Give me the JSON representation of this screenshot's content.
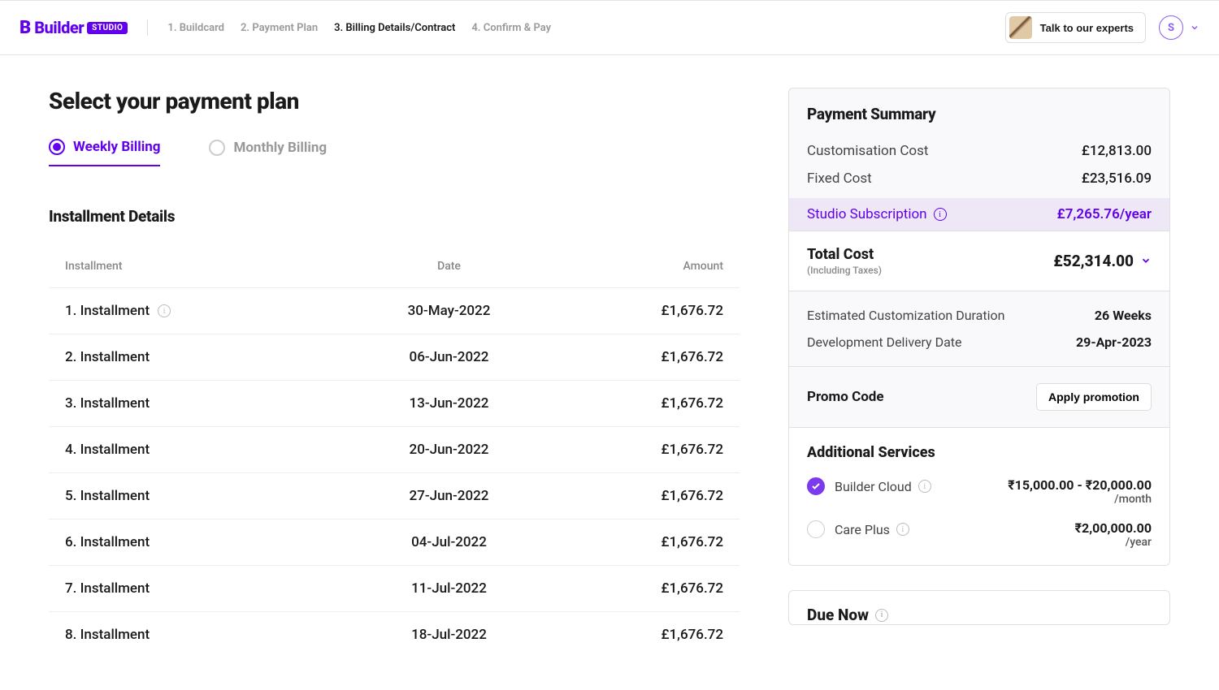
{
  "logo": {
    "brand": "Builder",
    "badge": "STUDIO"
  },
  "breadcrumbs": [
    {
      "label": "1. Buildcard",
      "active": false
    },
    {
      "label": "2. Payment Plan",
      "active": false
    },
    {
      "label": "3. Billing Details/Contract",
      "active": true
    },
    {
      "label": "4. Confirm & Pay",
      "active": false
    }
  ],
  "header": {
    "expert_label": "Talk to our experts",
    "user_initial": "S"
  },
  "page_title": "Select your payment plan",
  "tabs": [
    {
      "label": "Weekly Billing",
      "active": true
    },
    {
      "label": "Monthly Billing",
      "active": false
    }
  ],
  "installment": {
    "title": "Installment Details",
    "columns": {
      "name": "Installment",
      "date": "Date",
      "amount": "Amount"
    },
    "rows": [
      {
        "name": "1. Installment",
        "date": "30-May-2022",
        "amount": "£1,676.72",
        "info": true
      },
      {
        "name": "2. Installment",
        "date": "06-Jun-2022",
        "amount": "£1,676.72",
        "info": false
      },
      {
        "name": "3. Installment",
        "date": "13-Jun-2022",
        "amount": "£1,676.72",
        "info": false
      },
      {
        "name": "4. Installment",
        "date": "20-Jun-2022",
        "amount": "£1,676.72",
        "info": false
      },
      {
        "name": "5. Installment",
        "date": "27-Jun-2022",
        "amount": "£1,676.72",
        "info": false
      },
      {
        "name": "6. Installment",
        "date": "04-Jul-2022",
        "amount": "£1,676.72",
        "info": false
      },
      {
        "name": "7. Installment",
        "date": "11-Jul-2022",
        "amount": "£1,676.72",
        "info": false
      },
      {
        "name": "8. Installment",
        "date": "18-Jul-2022",
        "amount": "£1,676.72",
        "info": false
      }
    ]
  },
  "summary": {
    "title": "Payment Summary",
    "rows": [
      {
        "label": "Customisation Cost",
        "value": "£12,813.00"
      },
      {
        "label": "Fixed Cost",
        "value": "£23,516.09"
      }
    ],
    "subscription": {
      "label": "Studio Subscription",
      "value": "£7,265.76/year"
    },
    "total": {
      "label": "Total Cost",
      "sub": "(Including Taxes)",
      "value": "£52,314.00"
    },
    "meta": [
      {
        "label": "Estimated Customization Duration",
        "value": "26 Weeks"
      },
      {
        "label": "Development Delivery Date",
        "value": "29-Apr-2023"
      }
    ],
    "promo": {
      "label": "Promo Code",
      "button": "Apply promotion"
    },
    "services": {
      "title": "Additional Services",
      "items": [
        {
          "name": "Builder Cloud",
          "price": "₹15,000.00 - ₹20,000.00",
          "period": "/month",
          "selected": true
        },
        {
          "name": "Care Plus",
          "price": "₹2,00,000.00",
          "period": "/year",
          "selected": false
        }
      ]
    }
  },
  "due": {
    "title": "Due Now"
  }
}
